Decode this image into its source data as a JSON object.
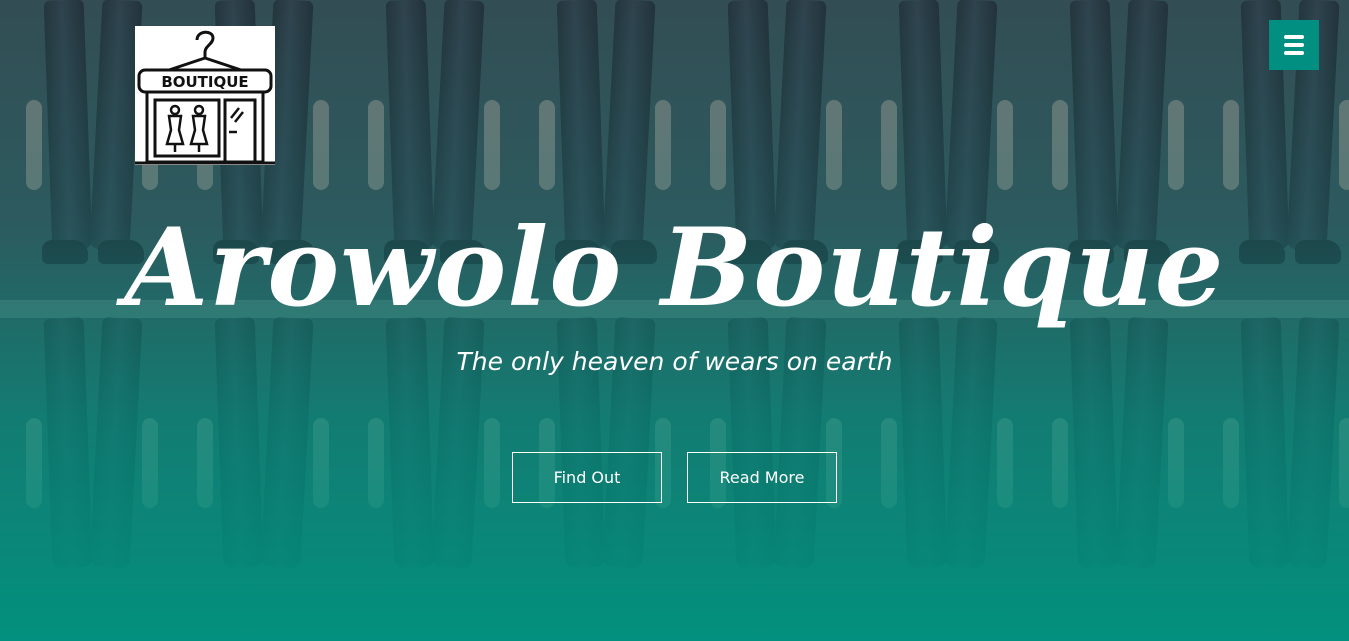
{
  "logo": {
    "text": "BOUTIQUE",
    "icon": "boutique-storefront-hanger-icon"
  },
  "header": {
    "menu_icon": "hamburger-menu-icon",
    "menu_color": "#008f80"
  },
  "hero": {
    "title": "Arowolo Boutique",
    "subtitle": "The only heaven of wears on earth",
    "buttons": {
      "find_out": "Find Out",
      "read_more": "Read More"
    },
    "overlay_color": "#00947f"
  }
}
